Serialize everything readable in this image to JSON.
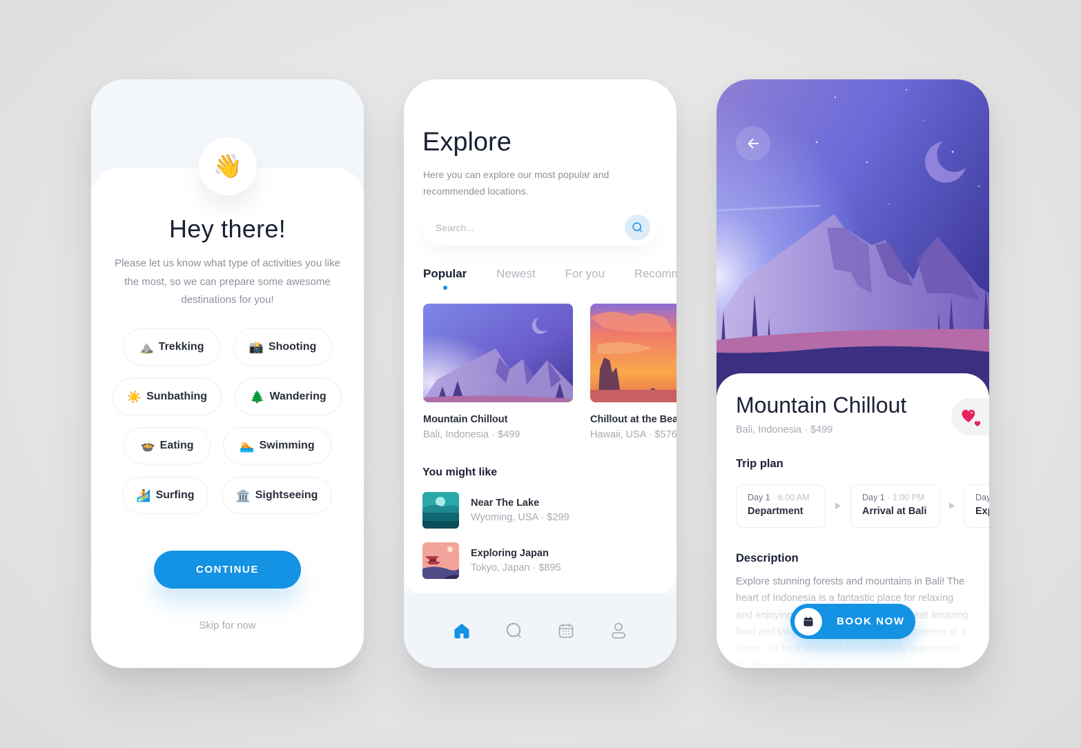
{
  "onboarding": {
    "wave_icon": "waving-hand-emoji",
    "wave_glyph": "👋",
    "title": "Hey there!",
    "description": "Please let us know what type of activities you like the most, so we can prepare some awesome destinations for you!",
    "activities": [
      {
        "label": "Trekking",
        "icon": "mountain-emoji",
        "glyph": "⛰️"
      },
      {
        "label": "Shooting",
        "icon": "camera-emoji",
        "glyph": "📸"
      },
      {
        "label": "Sunbathing",
        "icon": "sun-emoji",
        "glyph": "☀️"
      },
      {
        "label": "Wandering",
        "icon": "evergreen-tree-emoji",
        "glyph": "🌲"
      },
      {
        "label": "Eating",
        "icon": "bowl-emoji",
        "glyph": "🍲"
      },
      {
        "label": "Swimming",
        "icon": "swimmer-emoji",
        "glyph": "🏊"
      },
      {
        "label": "Surfing",
        "icon": "surfer-emoji",
        "glyph": "🏄"
      },
      {
        "label": "Sightseeing",
        "icon": "classical-building-emoji",
        "glyph": "🏛️"
      }
    ],
    "continue_label": "CONTINUE",
    "skip_label": "Skip for now"
  },
  "explore": {
    "title": "Explore",
    "description": "Here you can explore our most popular and recommended locations.",
    "search_placeholder": "Search...",
    "tabs": [
      {
        "label": "Popular",
        "active": true
      },
      {
        "label": "Newest",
        "active": false
      },
      {
        "label": "For you",
        "active": false
      },
      {
        "label": "Recommended",
        "active": false
      }
    ],
    "featured": [
      {
        "title": "Mountain Chillout",
        "subtitle": "Bali, Indonesia · $499"
      },
      {
        "title": "Chillout at the Beach",
        "subtitle": "Hawaii, USA · $576"
      }
    ],
    "you_might_like_title": "You might like",
    "you_might_like": [
      {
        "title": "Near The Lake",
        "subtitle": "Wyoming, USA · $299"
      },
      {
        "title": "Exploring Japan",
        "subtitle": "Tokyo, Japan · $895"
      }
    ],
    "nav": [
      {
        "name": "home-icon",
        "active": true
      },
      {
        "name": "search-icon",
        "active": false
      },
      {
        "name": "calendar-icon",
        "active": false
      },
      {
        "name": "profile-icon",
        "active": false
      }
    ]
  },
  "detail": {
    "title": "Mountain Chillout",
    "subtitle": "Bali, Indonesia · $499",
    "favorite_glyph": "💕",
    "trip_plan_title": "Trip plan",
    "trip_plan": [
      {
        "day": "Day 1",
        "time": "6:00 AM",
        "name": "Department"
      },
      {
        "day": "Day 1",
        "time": "1:00 PM",
        "name": "Arrival at Bali"
      },
      {
        "day": "Day",
        "time": "",
        "name": "Exp"
      }
    ],
    "description_title": "Description",
    "description": "Explore stunning forests and mountains in Bali! The heart of Indonesia is a fantastic place for relaxing and enjoying nature. You can hike, surf, eat amazing food and take breathtaking shots with a camera or a drone. It's best to visit in hot months to experience the best weather and local",
    "book_label": "BOOK NOW"
  },
  "colors": {
    "accent": "#1492e3",
    "heart": "#e8235c",
    "title_text": "#1b2135",
    "muted_text": "#8c919c"
  }
}
